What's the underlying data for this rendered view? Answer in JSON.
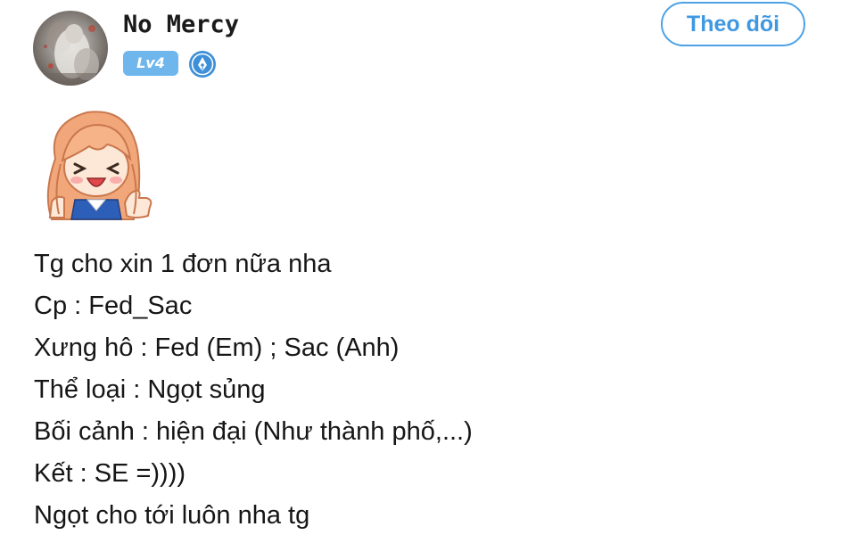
{
  "post": {
    "author": {
      "name": "No Mercy",
      "level": "Lv4",
      "avatar": "user-avatar-photo",
      "writer_badge_icon": "pen-nib-badge-icon"
    },
    "follow_button": {
      "label": "Theo dõi"
    },
    "sticker": "thumbs-up-anime-girl-sticker",
    "lines": [
      "Tg cho xin 1 đơn nữa nha",
      "Cp : Fed_Sac",
      "Xưng hô : Fed (Em) ; Sac (Anh)",
      "Thể loại : Ngọt sủng",
      "Bối cảnh : hiện đại (Như thành phố,...)",
      "Kết : SE =))))",
      "Ngọt cho tới luôn nha tg"
    ]
  },
  "colors": {
    "accent_blue": "#4da2e6",
    "level_badge": "#6fb6ec",
    "text": "#161616"
  }
}
